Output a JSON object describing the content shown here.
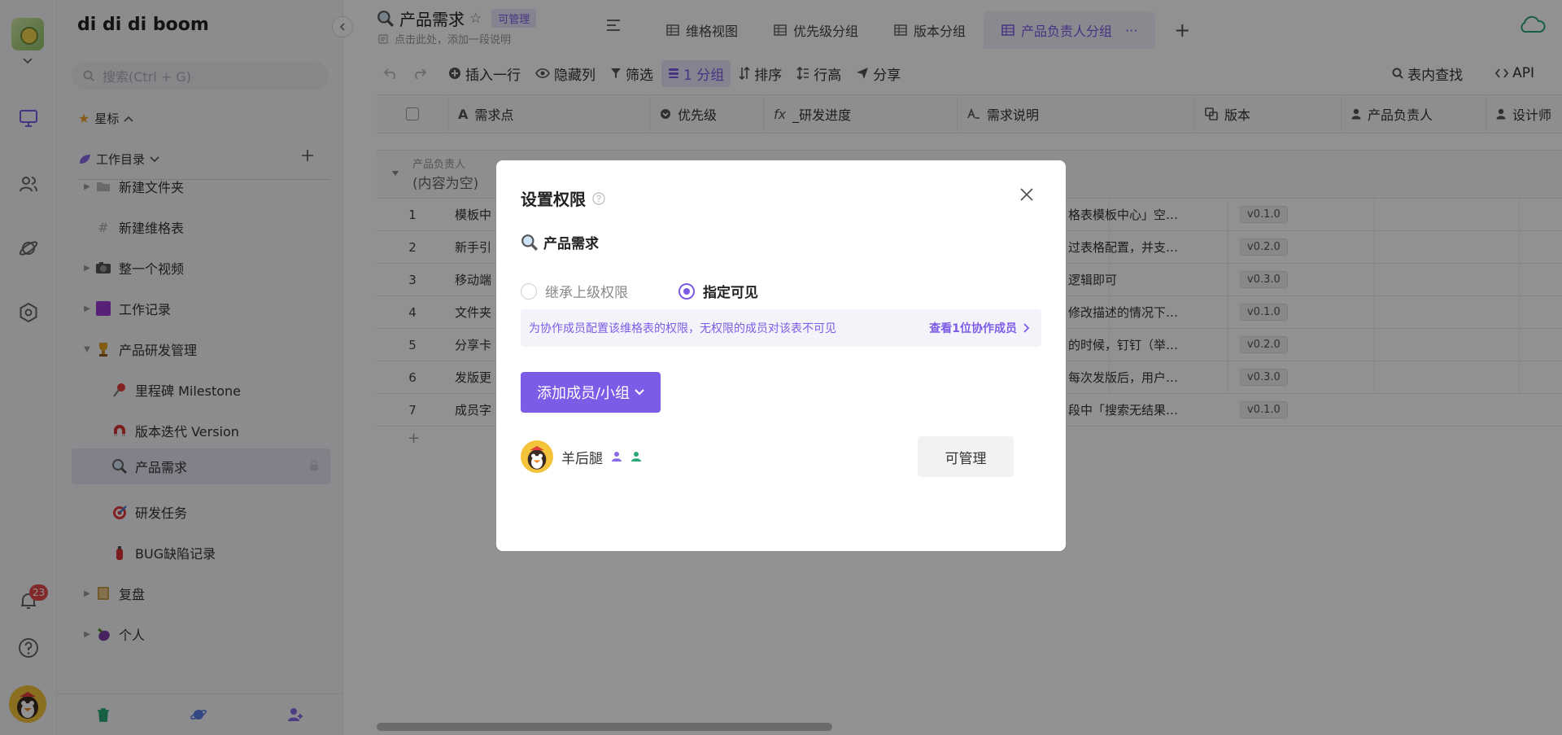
{
  "workspace": {
    "name": "di di di boom"
  },
  "rail": {
    "notifications_count": "23"
  },
  "sidebar": {
    "search_placeholder": "搜索(Ctrl + G)",
    "starred_label": "星标",
    "directory_label": "工作目录",
    "tree": [
      {
        "label": "新建文件夹",
        "icon": "folder-icon"
      },
      {
        "label": "新建维格表",
        "icon": "hash-icon"
      },
      {
        "label": "整一个视频",
        "icon": "camera-icon"
      },
      {
        "label": "工作记录",
        "icon": "purple-block-icon"
      },
      {
        "label": "产品研发管理",
        "icon": "trophy-icon"
      },
      {
        "label": "里程碑 Milestone",
        "icon": "pin-icon"
      },
      {
        "label": "版本迭代 Version",
        "icon": "magnet-icon"
      },
      {
        "label": "产品需求",
        "icon": "search-icon"
      },
      {
        "label": "研发任务",
        "icon": "target-icon"
      },
      {
        "label": "BUG缺陷记录",
        "icon": "extinguisher-icon"
      },
      {
        "label": "复盘",
        "icon": "book-icon"
      },
      {
        "label": "个人",
        "icon": "eggplant-icon"
      }
    ]
  },
  "header": {
    "doc_title": "产品需求",
    "permission_tag": "可管理",
    "description_hint": "点击此处，添加一段说明",
    "tabs": [
      {
        "label": "维格视图"
      },
      {
        "label": "优先级分组"
      },
      {
        "label": "版本分组"
      },
      {
        "label": "产品负责人分组",
        "more": "···"
      }
    ],
    "add_tab": "+"
  },
  "toolbar": {
    "insert_row": "插入一行",
    "hide_columns": "隐藏列",
    "filter": "筛选",
    "group": "1 分组",
    "sort": "排序",
    "row_height": "行高",
    "share": "分享",
    "find": "表内查找",
    "api": "API"
  },
  "grid": {
    "columns": [
      {
        "label": "需求点"
      },
      {
        "label": "优先级"
      },
      {
        "label": "_研发进度"
      },
      {
        "label": "需求说明"
      },
      {
        "label": "版本"
      },
      {
        "label": "产品负责人"
      },
      {
        "label": "设计师"
      }
    ],
    "group_field": "产品负责人",
    "group_value": "(内容为空)",
    "rows": [
      {
        "num": "1",
        "title": "模板中",
        "desc": "格表模板中心」空…",
        "version": "v0.1.0"
      },
      {
        "num": "2",
        "title": "新手引",
        "desc": "过表格配置，并支…",
        "version": "v0.2.0"
      },
      {
        "num": "3",
        "title": "移动端",
        "desc": "逻辑即可",
        "version": "v0.3.0"
      },
      {
        "num": "4",
        "title": "文件夹",
        "desc": "修改描述的情况下…",
        "version": "v0.1.0"
      },
      {
        "num": "5",
        "title": "分享卡",
        "desc": "的时候，钉钉（举…",
        "version": "v0.2.0"
      },
      {
        "num": "6",
        "title": "发版更",
        "desc": "每次发版后，用户…",
        "version": "v0.3.0"
      },
      {
        "num": "7",
        "title": "成员字",
        "desc": "段中「搜索无结果…",
        "version": "v0.1.0"
      }
    ],
    "add_row": "+"
  },
  "modal": {
    "title": "设置权限",
    "doc_name": "产品需求",
    "option_inherit": "继承上级权限",
    "option_specified": "指定可见",
    "selected_option": "指定可见",
    "hint": "为协作成员配置该维格表的权限，无权限的成员对该表不可见",
    "hint_link": "查看1位协作成员",
    "add_button": "添加成员/小组",
    "member": {
      "name": "羊后腿",
      "role": "可管理"
    }
  },
  "colors": {
    "accent": "#7c5ce6",
    "badge": "#e5484d"
  }
}
